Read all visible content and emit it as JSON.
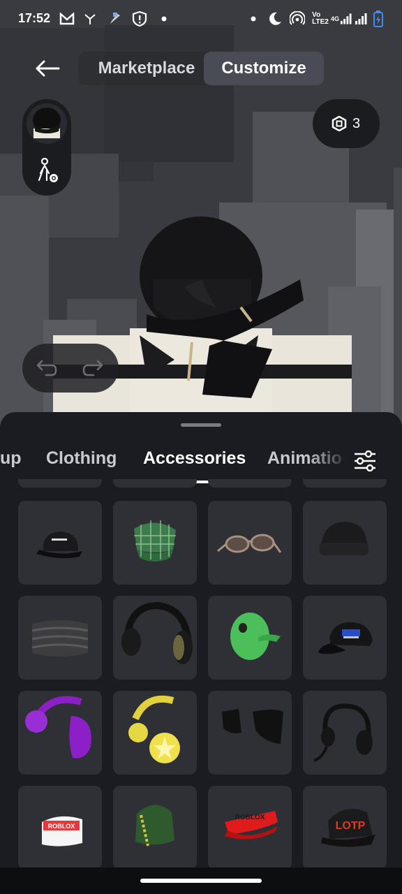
{
  "status_bar": {
    "time": "17:52",
    "left_icons": [
      "gmail-icon",
      "app-icon",
      "app-icon-2",
      "shield-alert-icon",
      "dot-icon"
    ],
    "right_icons": [
      "dot-icon",
      "moon-icon",
      "hotspot-icon",
      "volte-icon",
      "signal-4g-icon",
      "signal-icon",
      "battery-charging-icon"
    ],
    "volte_label": "Vo\nLTE2",
    "network_label": "4G"
  },
  "top_nav": {
    "back_icon": "arrow-left-icon",
    "tabs": [
      {
        "label": "Marketplace",
        "active": false
      },
      {
        "label": "Customize",
        "active": true
      }
    ]
  },
  "robux": {
    "icon": "robux-icon",
    "count": "3"
  },
  "avatar_controls": {
    "head_icon": "avatar-head-icon",
    "settings_icon": "avatar-settings-icon"
  },
  "history": {
    "undo_icon": "undo-icon",
    "redo_icon": "redo-icon"
  },
  "category_tabs": [
    {
      "label": "up",
      "active": false
    },
    {
      "label": "Clothing",
      "active": false
    },
    {
      "label": "Accessories",
      "active": true
    },
    {
      "label": "Animatio",
      "active": false
    }
  ],
  "filter_icon": "sliders-icon",
  "items": [
    {
      "name": "black-roblox-cap"
    },
    {
      "name": "green-plaid-cap"
    },
    {
      "name": "round-sunglasses"
    },
    {
      "name": "black-beanie"
    },
    {
      "name": "gray-scarf"
    },
    {
      "name": "black-headphones"
    },
    {
      "name": "green-alien-head"
    },
    {
      "name": "black-cap-logo"
    },
    {
      "name": "purple-earmuffs"
    },
    {
      "name": "yellow-star-headphones"
    },
    {
      "name": "cat-ears"
    },
    {
      "name": "gaming-headset"
    },
    {
      "name": "roblox-white-cap"
    },
    {
      "name": "green-hood"
    },
    {
      "name": "roblox-red-visor"
    },
    {
      "name": "lotp-cap"
    }
  ],
  "item_texts": {
    "roblox": "ROBLOX",
    "lotp": "LOTP"
  }
}
